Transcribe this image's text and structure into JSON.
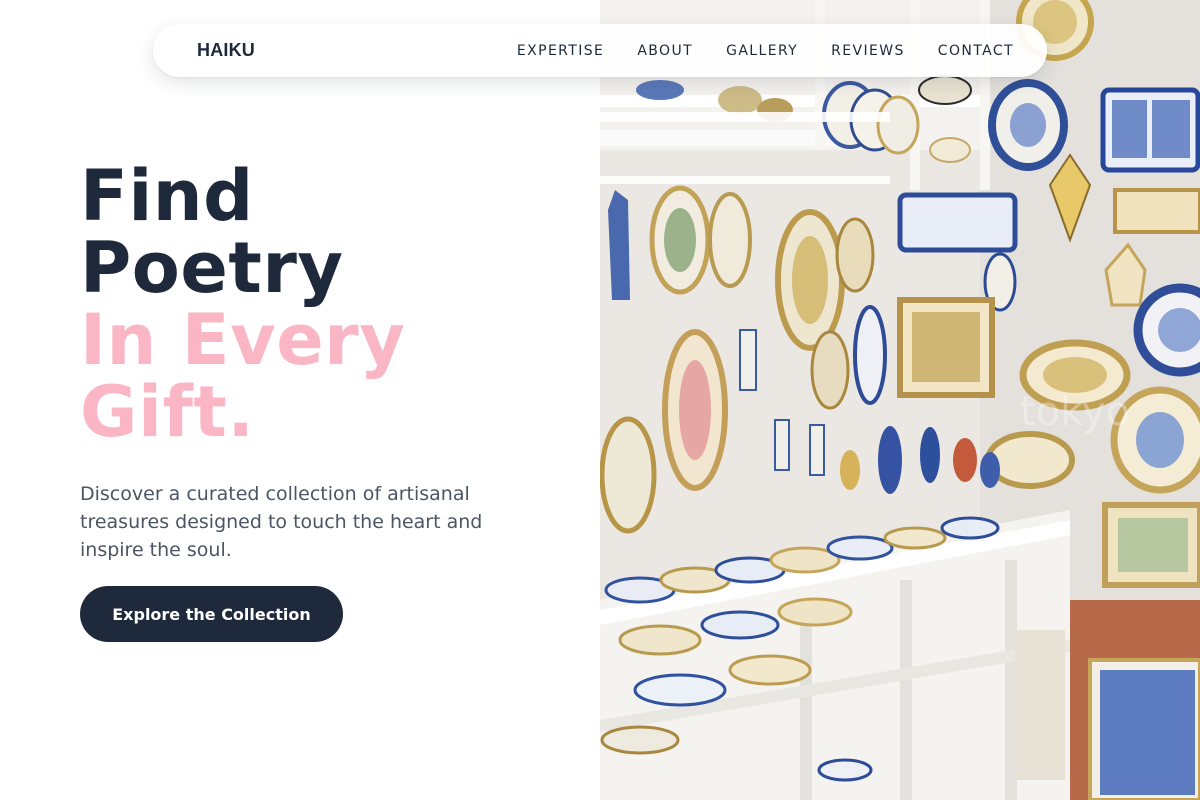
{
  "nav": {
    "logo": "HAIKU",
    "links": [
      "EXPERTISE",
      "ABOUT",
      "GALLERY",
      "REVIEWS",
      "CONTACT"
    ]
  },
  "hero": {
    "headline_line1": "Find",
    "headline_line2": "Poetry",
    "headline_accent_line1": "In Every",
    "headline_accent_line2": "Gift.",
    "subtext": "Discover a curated collection of artisanal treasures designed to touch the heart and inspire the soul.",
    "cta_label": "Explore the Collection",
    "image_alt": "Shop wall and shelves filled with hand-painted ceramic plates, bowls and tiles",
    "image_watermark": "tokyo"
  },
  "colors": {
    "primary_dark": "#1e293b",
    "accent_pink": "#fbb6c6",
    "body_text": "#4b5563",
    "background": "#ffffff"
  }
}
